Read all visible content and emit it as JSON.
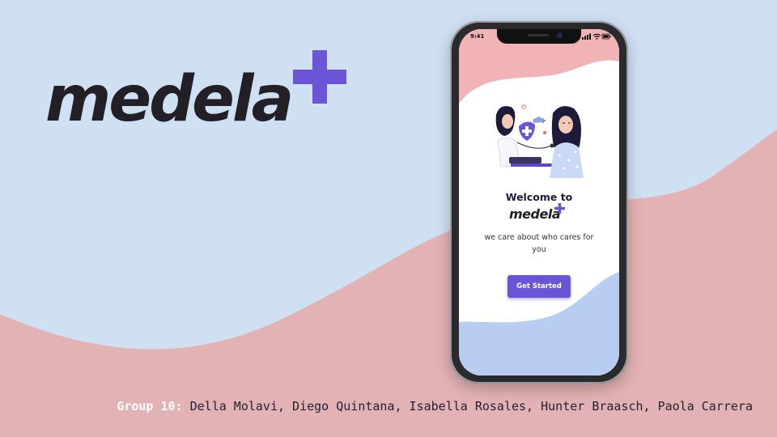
{
  "logo": {
    "wordmark": "medela",
    "plus_icon": "plus-icon"
  },
  "phone": {
    "status_time": "9:41",
    "status_icons": [
      "signal-icon",
      "wifi-icon",
      "battery-icon"
    ],
    "illustration": "doctor-patient-illustration",
    "welcome_title": "Welcome to",
    "app_name": "medela",
    "tagline": "we care about who cares for you",
    "cta_label": "Get Started"
  },
  "credits": {
    "group_label": "Group 10:",
    "members": "Della Molavi, Diego Quintana, Isabella Rosales, Hunter Braasch, Paola Carrera"
  },
  "colors": {
    "background_blue": "#cfe0f3",
    "background_pink": "#e3b2b4",
    "brand_purple": "#6a55d6",
    "text_dark": "#222026"
  }
}
